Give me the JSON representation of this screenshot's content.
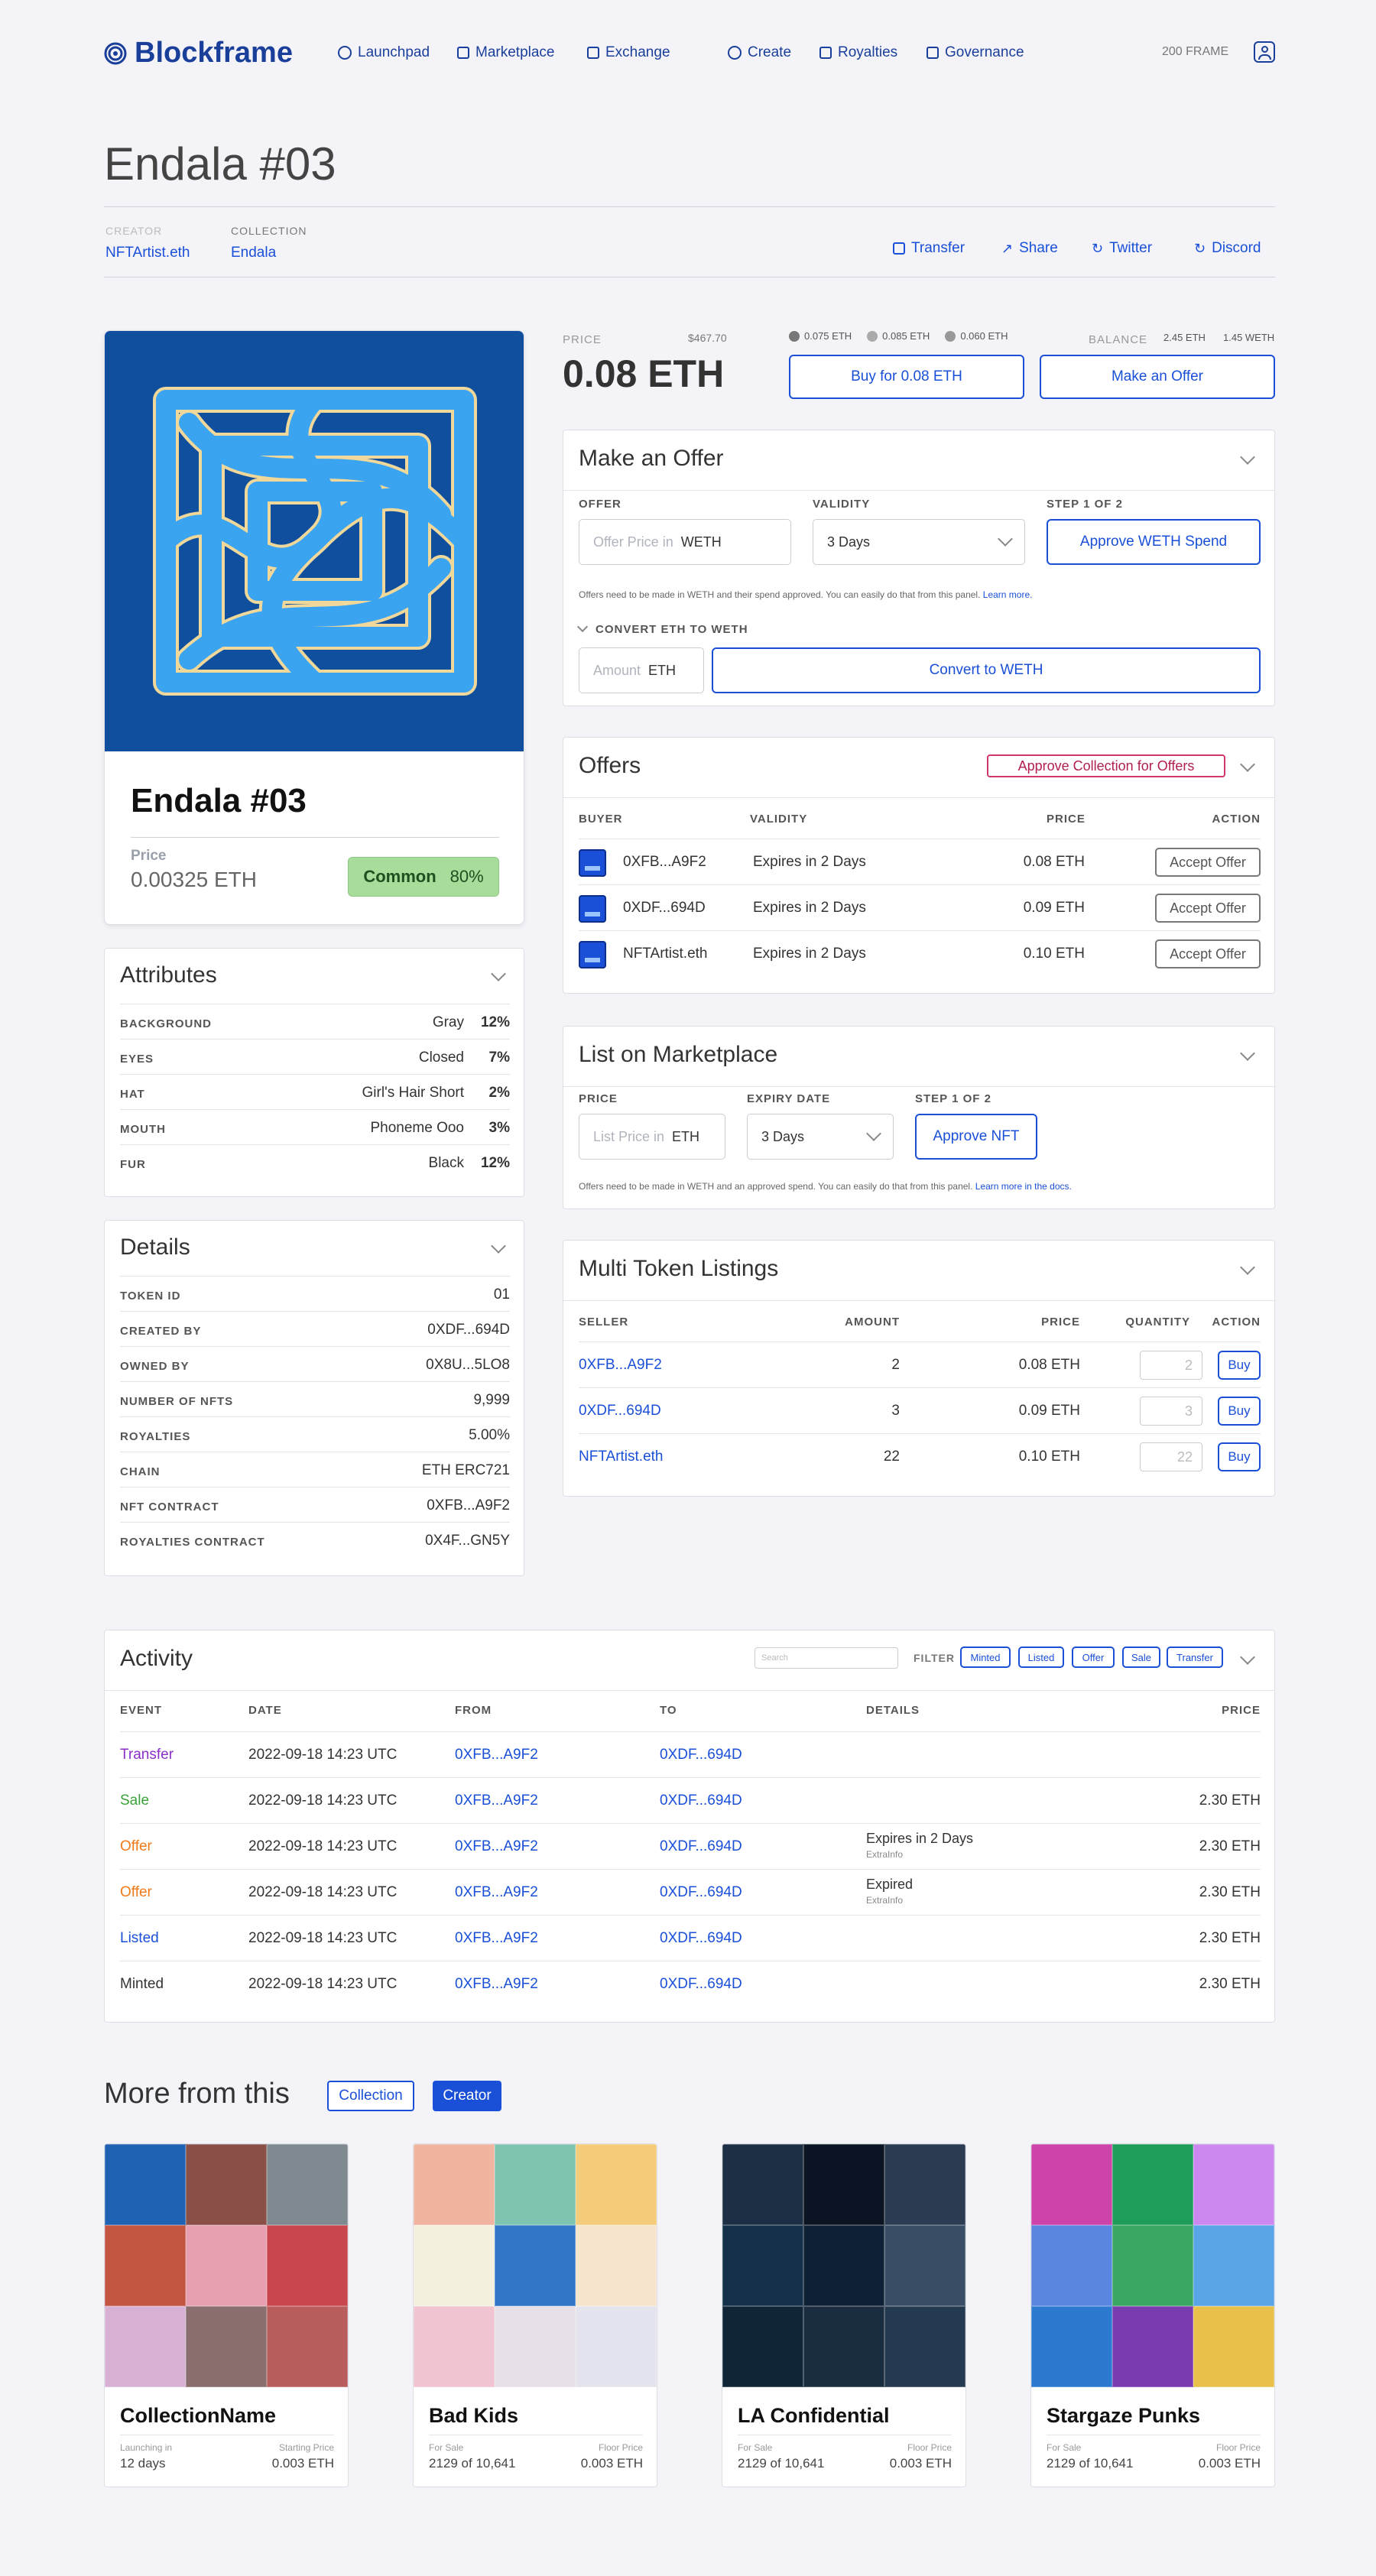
{
  "app": {
    "brand": "Blockframe",
    "balance": "200 FRAME"
  },
  "nav": [
    "Launchpad",
    "Marketplace",
    "Exchange",
    "Create",
    "Royalties",
    "Governance"
  ],
  "page": {
    "title": "Endala #03",
    "creator_label": "CREATOR",
    "creator": "NFTArtist.eth",
    "collection_label": "COLLECTION",
    "collection": "Endala",
    "actions": [
      "Transfer",
      "Share",
      "Twitter",
      "Discord"
    ]
  },
  "nft": {
    "name": "Endala #03",
    "price_label": "Price",
    "price": "0.00325 ETH",
    "rarity": "Common",
    "rarity_pct": "80%"
  },
  "pricing": {
    "label": "PRICE",
    "usd": "$467.70",
    "price": "0.08 ETH",
    "stats": [
      "0.075 ETH",
      "0.085 ETH",
      "0.060 ETH"
    ],
    "balance_label": "BALANCE",
    "bal_eth": "2.45 ETH",
    "bal_weth": "1.45 WETH",
    "buy": "Buy for 0.08 ETH",
    "offer": "Make an Offer"
  },
  "offer_panel": {
    "title": "Make an Offer",
    "offer_label": "OFFER",
    "validity_label": "VALIDITY",
    "step_label": "STEP 1 OF 2",
    "offer_ph": "Offer Price in",
    "offer_unit": "WETH",
    "validity": "3 Days",
    "approve": "Approve WETH Spend",
    "note": "Offers need to be made in WETH and their spend approved. You can easily do that from this panel.",
    "learn": "Learn more.",
    "convert_label": "CONVERT ETH TO WETH",
    "amount_ph": "Amount",
    "amount_unit": "ETH",
    "convert": "Convert to WETH"
  },
  "offers": {
    "title": "Offers",
    "approve": "Approve Collection for Offers",
    "headers": [
      "BUYER",
      "VALIDITY",
      "PRICE",
      "ACTION"
    ],
    "rows": [
      {
        "buyer": "0XFB...A9F2",
        "validity": "Expires in 2 Days",
        "price": "0.08 ETH",
        "action": "Accept Offer"
      },
      {
        "buyer": "0XDF...694D",
        "validity": "Expires in 2 Days",
        "price": "0.09 ETH",
        "action": "Accept Offer"
      },
      {
        "buyer": "NFTArtist.eth",
        "validity": "Expires in 2 Days",
        "price": "0.10 ETH",
        "action": "Accept Offer"
      }
    ]
  },
  "list_panel": {
    "title": "List on Marketplace",
    "price_label": "PRICE",
    "expiry_label": "EXPIRY DATE",
    "step_label": "STEP 1 OF 2",
    "price_ph": "List Price in",
    "price_unit": "ETH",
    "expiry": "3 Days",
    "approve": "Approve NFT",
    "note": "Offers need to be made in WETH and an approved spend. You can easily do that from this panel.",
    "learn": "Learn more in the docs."
  },
  "multi": {
    "title": "Multi Token Listings",
    "headers": [
      "SELLER",
      "AMOUNT",
      "PRICE",
      "QUANTITY",
      "ACTION"
    ],
    "rows": [
      {
        "seller": "0XFB...A9F2",
        "amount": "2",
        "price": "0.08 ETH",
        "qty": "2",
        "action": "Buy"
      },
      {
        "seller": "0XDF...694D",
        "amount": "3",
        "price": "0.09 ETH",
        "qty": "3",
        "action": "Buy"
      },
      {
        "seller": "NFTArtist.eth",
        "amount": "22",
        "price": "0.10 ETH",
        "qty": "22",
        "action": "Buy"
      }
    ]
  },
  "attributes": {
    "title": "Attributes",
    "rows": [
      {
        "k": "BACKGROUND",
        "v": "Gray",
        "p": "12%"
      },
      {
        "k": "EYES",
        "v": "Closed",
        "p": "7%"
      },
      {
        "k": "HAT",
        "v": "Girl's Hair Short",
        "p": "2%"
      },
      {
        "k": "MOUTH",
        "v": "Phoneme Ooo",
        "p": "3%"
      },
      {
        "k": "FUR",
        "v": "Black",
        "p": "12%"
      }
    ]
  },
  "details": {
    "title": "Details",
    "rows": [
      {
        "k": "TOKEN ID",
        "v": "01"
      },
      {
        "k": "CREATED BY",
        "v": "0XDF...694D"
      },
      {
        "k": "OWNED BY",
        "v": "0X8U...5LO8"
      },
      {
        "k": "NUMBER OF NFTS",
        "v": "9,999"
      },
      {
        "k": "ROYALTIES",
        "v": "5.00%"
      },
      {
        "k": "CHAIN",
        "v": "ETH ERC721"
      },
      {
        "k": "NFT CONTRACT",
        "v": "0XFB...A9F2"
      },
      {
        "k": "ROYALTIES CONTRACT",
        "v": "0X4F...GN5Y"
      }
    ]
  },
  "activity": {
    "title": "Activity",
    "search_ph": "Search",
    "filter_label": "FILTER",
    "filters": [
      "Minted",
      "Listed",
      "Offer",
      "Sale",
      "Transfer"
    ],
    "headers": [
      "EVENT",
      "DATE",
      "FROM",
      "TO",
      "DETAILS",
      "PRICE"
    ],
    "rows": [
      {
        "event": "Transfer",
        "color": "#8b2fc9",
        "date": "2022-09-18 14:23 UTC",
        "from": "0XFB...A9F2",
        "to": "0XDF...694D",
        "details": "",
        "sub": "",
        "price": ""
      },
      {
        "event": "Sale",
        "color": "#3aa33a",
        "date": "2022-09-18 14:23 UTC",
        "from": "0XFB...A9F2",
        "to": "0XDF...694D",
        "details": "",
        "sub": "",
        "price": "2.30 ETH"
      },
      {
        "event": "Offer",
        "color": "#f07a18",
        "date": "2022-09-18 14:23 UTC",
        "from": "0XFB...A9F2",
        "to": "0XDF...694D",
        "details": "Expires in 2 Days",
        "sub": "ExtraInfo",
        "price": "2.30 ETH"
      },
      {
        "event": "Offer",
        "color": "#f07a18",
        "date": "2022-09-18 14:23 UTC",
        "from": "0XFB...A9F2",
        "to": "0XDF...694D",
        "details": "Expired",
        "sub": "ExtraInfo",
        "price": "2.30 ETH"
      },
      {
        "event": "Listed",
        "color": "#1a4fd8",
        "date": "2022-09-18 14:23 UTC",
        "from": "0XFB...A9F2",
        "to": "0XDF...694D",
        "details": "",
        "sub": "",
        "price": "2.30 ETH"
      },
      {
        "event": "Minted",
        "color": "#333333",
        "date": "2022-09-18 14:23 UTC",
        "from": "0XFB...A9F2",
        "to": "0XDF...694D",
        "details": "",
        "sub": "",
        "price": "2.30 ETH"
      }
    ]
  },
  "more": {
    "title": "More from this",
    "tab_collection": "Collection",
    "tab_creator": "Creator",
    "cards": [
      {
        "name": "CollectionName",
        "l1": "Launching in",
        "v1": "12 days",
        "l2": "Starting Price",
        "v2": "0.003 ETH"
      },
      {
        "name": "Bad Kids",
        "l1": "For Sale",
        "v1": "2129 of 10,641",
        "l2": "Floor Price",
        "v2": "0.003 ETH"
      },
      {
        "name": "LA Confidential",
        "l1": "For Sale",
        "v1": "2129 of 10,641",
        "l2": "Floor Price",
        "v2": "0.003 ETH"
      },
      {
        "name": "Stargaze Punks",
        "l1": "For Sale",
        "v1": "2129 of 10,641",
        "l2": "Floor Price",
        "v2": "0.003 ETH"
      }
    ]
  }
}
